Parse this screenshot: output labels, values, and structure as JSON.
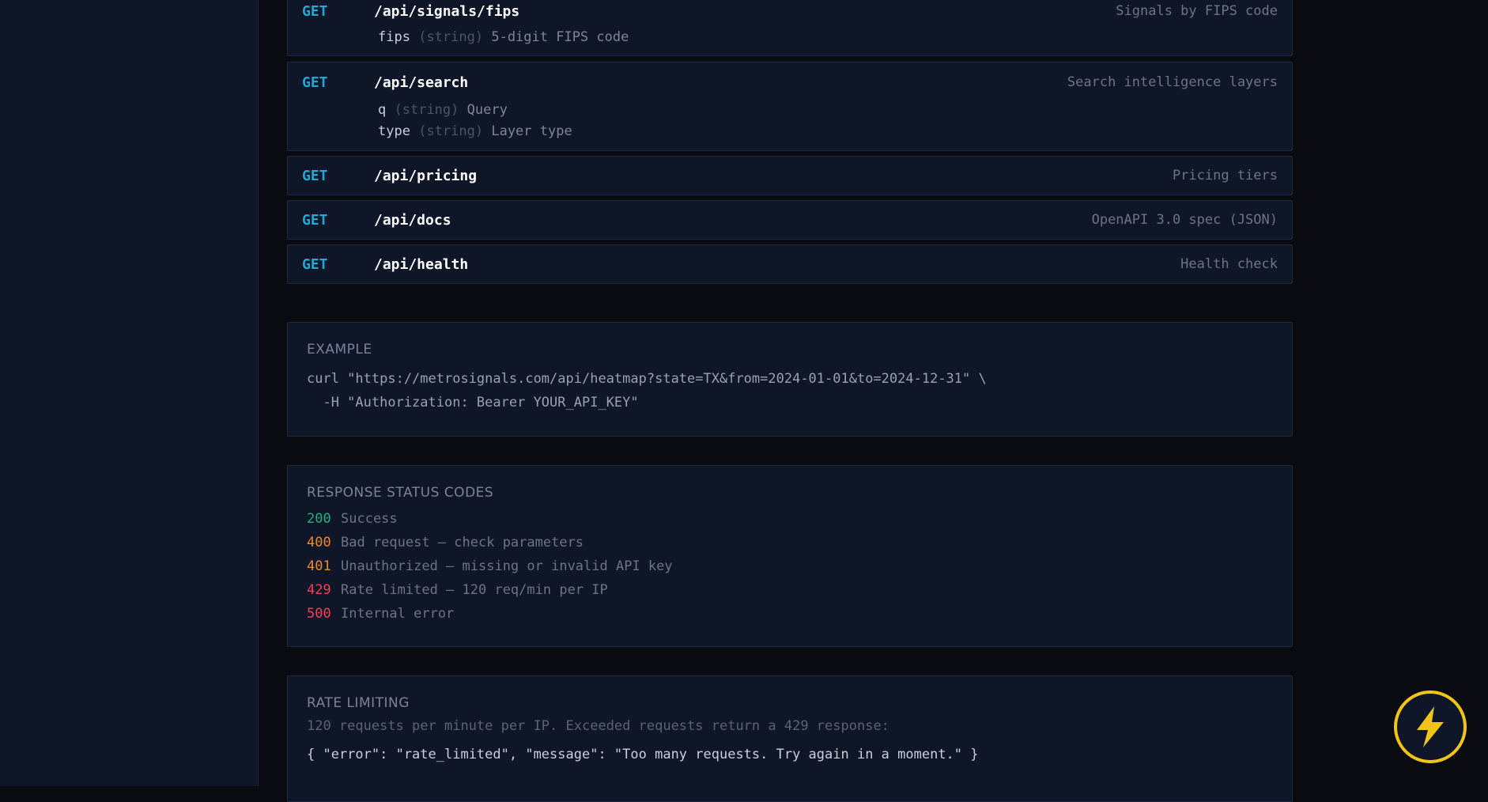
{
  "endpoints": [
    {
      "method": "GET",
      "path": "/api/signals/fips",
      "description": "Signals by FIPS code",
      "params": [
        {
          "name": "fips",
          "type": "(string)",
          "desc": "5-digit FIPS code"
        }
      ]
    },
    {
      "method": "GET",
      "path": "/api/search",
      "description": "Search intelligence layers",
      "params": [
        {
          "name": "q",
          "type": "(string)",
          "desc": "Query"
        },
        {
          "name": "type",
          "type": "(string)",
          "desc": "Layer type"
        }
      ]
    },
    {
      "method": "GET",
      "path": "/api/pricing",
      "description": "Pricing tiers",
      "params": []
    },
    {
      "method": "GET",
      "path": "/api/docs",
      "description": "OpenAPI 3.0 spec (JSON)",
      "params": []
    },
    {
      "method": "GET",
      "path": "/api/health",
      "description": "Health check",
      "params": []
    }
  ],
  "example": {
    "title": "EXAMPLE",
    "line1": "curl \"https://metrosignals.com/api/heatmap?state=TX&from=2024-01-01&to=2024-12-31\" \\",
    "line2": "  -H \"Authorization: Bearer YOUR_API_KEY\""
  },
  "status_codes": {
    "title": "RESPONSE STATUS CODES",
    "items": [
      {
        "code": "200",
        "text": "Success",
        "color": "#22b07d"
      },
      {
        "code": "400",
        "text": "Bad request — check parameters",
        "color": "#f08a24"
      },
      {
        "code": "401",
        "text": "Unauthorized — missing or invalid API key",
        "color": "#f08a24"
      },
      {
        "code": "429",
        "text": "Rate limited — 120 req/min per IP",
        "color": "#f0435a"
      },
      {
        "code": "500",
        "text": "Internal error",
        "color": "#f0435a"
      }
    ]
  },
  "rate_limiting": {
    "title": "RATE LIMITING",
    "text": "120 requests per minute per IP. Exceeded requests return a 429 response:",
    "json": "{ \"error\": \"rate_limited\", \"message\": \"Too many requests. Try again in a moment.\" }"
  },
  "fab": {
    "icon": "lightning-bolt-icon",
    "accent": "#f0c419"
  }
}
